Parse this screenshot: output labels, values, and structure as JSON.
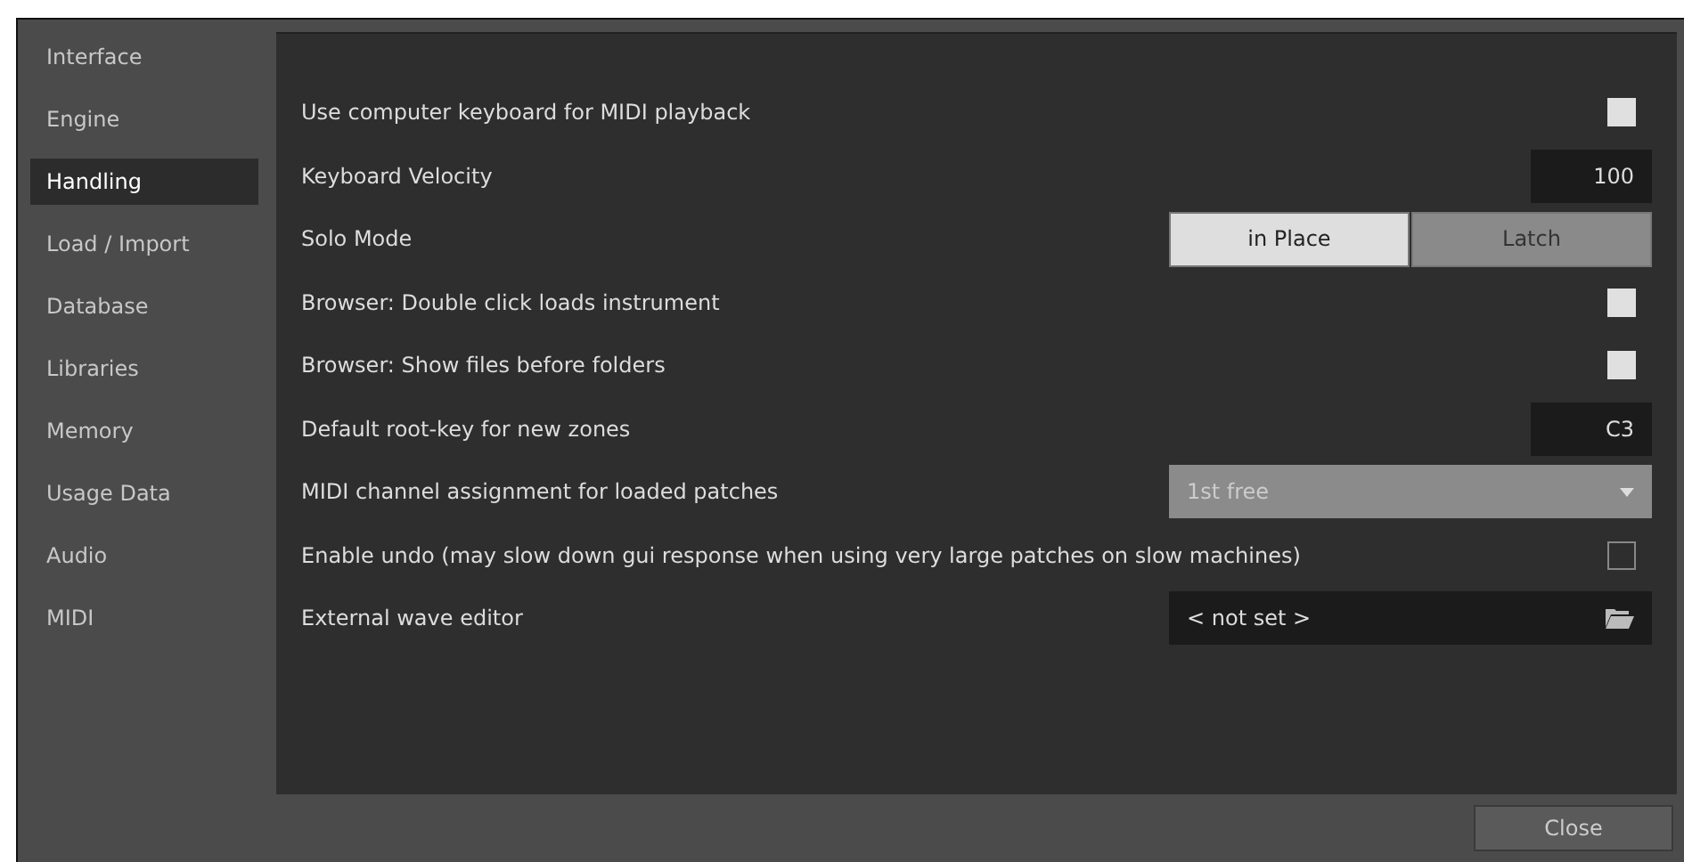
{
  "sidebar": {
    "items": [
      {
        "label": "Interface",
        "selected": false
      },
      {
        "label": "Engine",
        "selected": false
      },
      {
        "label": "Handling",
        "selected": true
      },
      {
        "label": "Load / Import",
        "selected": false
      },
      {
        "label": "Database",
        "selected": false
      },
      {
        "label": "Libraries",
        "selected": false
      },
      {
        "label": "Memory",
        "selected": false
      },
      {
        "label": "Usage Data",
        "selected": false
      },
      {
        "label": "Audio",
        "selected": false
      },
      {
        "label": "MIDI",
        "selected": false
      }
    ]
  },
  "settings": [
    {
      "kind": "checkbox",
      "label": "Use computer keyboard for MIDI playback",
      "checked": true
    },
    {
      "kind": "value",
      "label": "Keyboard Velocity",
      "value": "100"
    },
    {
      "kind": "segmented",
      "label": "Solo Mode",
      "options": [
        {
          "label": "in Place",
          "selected": true
        },
        {
          "label": "Latch",
          "selected": false
        }
      ]
    },
    {
      "kind": "checkbox",
      "label": "Browser: Double click loads instrument",
      "checked": true
    },
    {
      "kind": "checkbox",
      "label": "Browser: Show files before folders",
      "checked": true
    },
    {
      "kind": "value",
      "label": "Default root-key for new zones",
      "value": "C3"
    },
    {
      "kind": "dropdown",
      "label": "MIDI channel assignment for loaded patches",
      "value": "1st free"
    },
    {
      "kind": "checkbox",
      "label": "Enable undo (may slow down gui response when using very large patches on slow machines)",
      "checked": false
    },
    {
      "kind": "file",
      "label": "External wave editor",
      "value": "< not set >"
    }
  ],
  "buttons": [
    "Close"
  ]
}
